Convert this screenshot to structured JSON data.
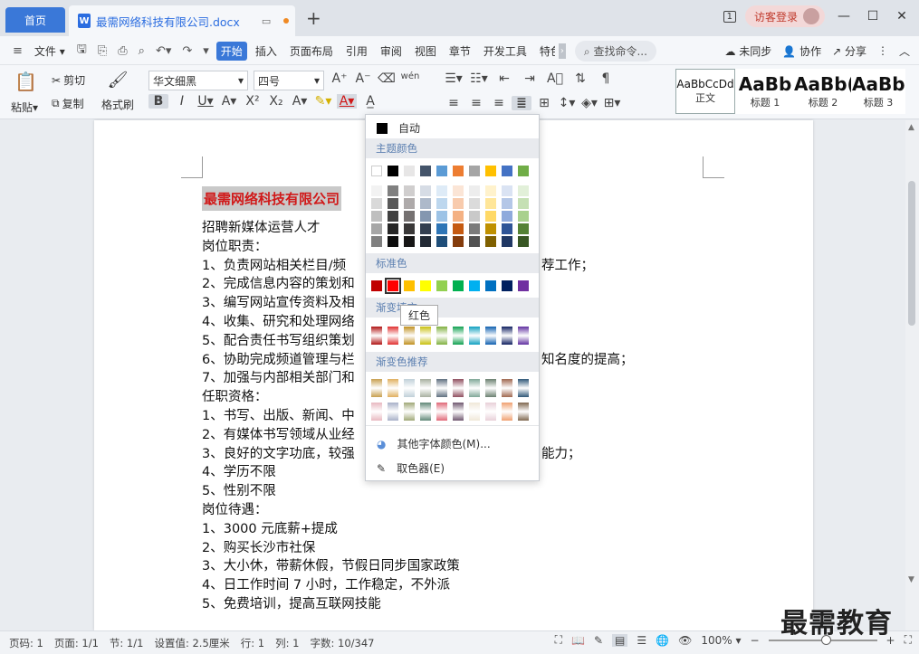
{
  "titlebar": {
    "home_tab": "首页",
    "doc_tab_icon": "W",
    "doc_name": "最需网络科技有限公司.docx",
    "new_tab": "+",
    "window_count": "1",
    "login": "访客登录",
    "minimize": "—",
    "maximize": "☐",
    "close": "✕"
  },
  "menubar": {
    "file": "文件",
    "tabs": [
      "开始",
      "插入",
      "页面布局",
      "引用",
      "审阅",
      "视图",
      "章节",
      "开发工具",
      "特色"
    ],
    "active_tab": "开始",
    "search": "查找命令...",
    "sync": "未同步",
    "collab": "协作",
    "share": "分享"
  },
  "ribbon": {
    "paste": "粘贴",
    "cut": "剪切",
    "copy": "复制",
    "format_painter": "格式刷",
    "font_name": "华文细黑",
    "font_size": "四号",
    "styles": [
      {
        "preview": "AaBbCcDd",
        "label": "正文"
      },
      {
        "preview": "AaBb",
        "label": "标题 1"
      },
      {
        "preview": "AaBb(",
        "label": "标题 2"
      },
      {
        "preview": "AaBbC",
        "label": "标题 3"
      }
    ]
  },
  "document": {
    "heading": "最需网络科技有限公司",
    "lines": [
      "招聘新媒体运营人才",
      "岗位职责：",
      "1、负责网站相关栏目/频",
      "2、完成信息内容的策划和",
      "3、编写网站宣传资料及相",
      "4、收集、研究和处理网络",
      "5、配合责任书写组织策划",
      "6、协助完成频道管理与栏",
      "7、加强与内部相关部门和",
      "任职资格：",
      "1、书写、出版、新闻、中",
      "2、有媒体书写领域从业经",
      "3、良好的文字功底，较强",
      "4、学历不限",
      "5、性别不限",
      "岗位待遇：",
      "1、3000 元底薪+提成",
      "2、购买长沙市社保",
      "3、大小休，带薪休假，节假日同步国家政策",
      "4、日工作时间 7 小时，工作稳定，不外派",
      "5、免费培训，提高互联网技能"
    ],
    "right_fragments": [
      {
        "line": 2,
        "text": "荐工作；"
      },
      {
        "line": 7,
        "text": "知名度的提高；"
      },
      {
        "line": 12,
        "text": "能力；"
      }
    ]
  },
  "color_panel": {
    "auto": "自动",
    "theme_colors": "主题颜色",
    "standard": "标准色",
    "gradient": "渐变填充",
    "gradient_rec": "渐变色推荐",
    "more_colors": "其他字体颜色(M)...",
    "picker": "取色器(E)",
    "tooltip": "红色",
    "theme_row": [
      "#ffffff",
      "#000000",
      "#e7e6e6",
      "#44546a",
      "#5b9bd5",
      "#ed7d31",
      "#a5a5a5",
      "#ffc000",
      "#4472c4",
      "#70ad47"
    ],
    "shade_cols": [
      [
        "#f2f2f2",
        "#d9d9d9",
        "#bfbfbf",
        "#a6a6a6",
        "#808080"
      ],
      [
        "#808080",
        "#595959",
        "#404040",
        "#262626",
        "#0d0d0d"
      ],
      [
        "#d0cece",
        "#aeaaaa",
        "#757171",
        "#3a3838",
        "#171616"
      ],
      [
        "#d6dce5",
        "#adb9ca",
        "#8497b0",
        "#333f50",
        "#222a35"
      ],
      [
        "#deebf7",
        "#bdd7ee",
        "#9dc3e6",
        "#2e75b6",
        "#1f4e79"
      ],
      [
        "#fbe5d6",
        "#f8cbad",
        "#f4b183",
        "#c55a11",
        "#843c0c"
      ],
      [
        "#ededed",
        "#dbdbdb",
        "#c9c9c9",
        "#7b7b7b",
        "#525252"
      ],
      [
        "#fff2cc",
        "#ffe699",
        "#ffd966",
        "#bf9000",
        "#7f6000"
      ],
      [
        "#dae3f3",
        "#b4c7e7",
        "#8faadc",
        "#2f5597",
        "#203864"
      ],
      [
        "#e2f0d9",
        "#c5e0b4",
        "#a9d18e",
        "#548235",
        "#385723"
      ]
    ],
    "standard_row": [
      "#c00000",
      "#ff0000",
      "#ffc000",
      "#ffff00",
      "#92d050",
      "#00b050",
      "#00b0f0",
      "#0070c0",
      "#002060",
      "#7030a0"
    ],
    "gradient_row": [
      "#b01515",
      "#e03030",
      "#c09020",
      "#c8c010",
      "#80b040",
      "#10a050",
      "#10a0c0",
      "#1060b0",
      "#102060",
      "#6030a0"
    ],
    "rec_row1": [
      "#c8a050",
      "#e0b060",
      "#c0d0d8",
      "#a8b0a0",
      "#607080",
      "#905060",
      "#80a898",
      "#6b8070",
      "#a06850",
      "#305878"
    ],
    "rec_row2": [
      "#e8b8c0",
      "#a8b0c8",
      "#a0a878",
      "#608878",
      "#e06878",
      "#705870",
      "#f0e8d8",
      "#e8d0d8",
      "#f0a070",
      "#806850"
    ]
  },
  "statusbar": {
    "page": "页码: 1",
    "pages": "页面: 1/1",
    "section": "节: 1/1",
    "setting": "设置值: 2.5厘米",
    "row": "行: 1",
    "col": "列: 1",
    "words": "字数: 10/347",
    "zoom": "100%"
  },
  "watermark": "最需教育",
  "colors": {
    "accent": "#3a78d8",
    "heading_red": "#d01818"
  }
}
